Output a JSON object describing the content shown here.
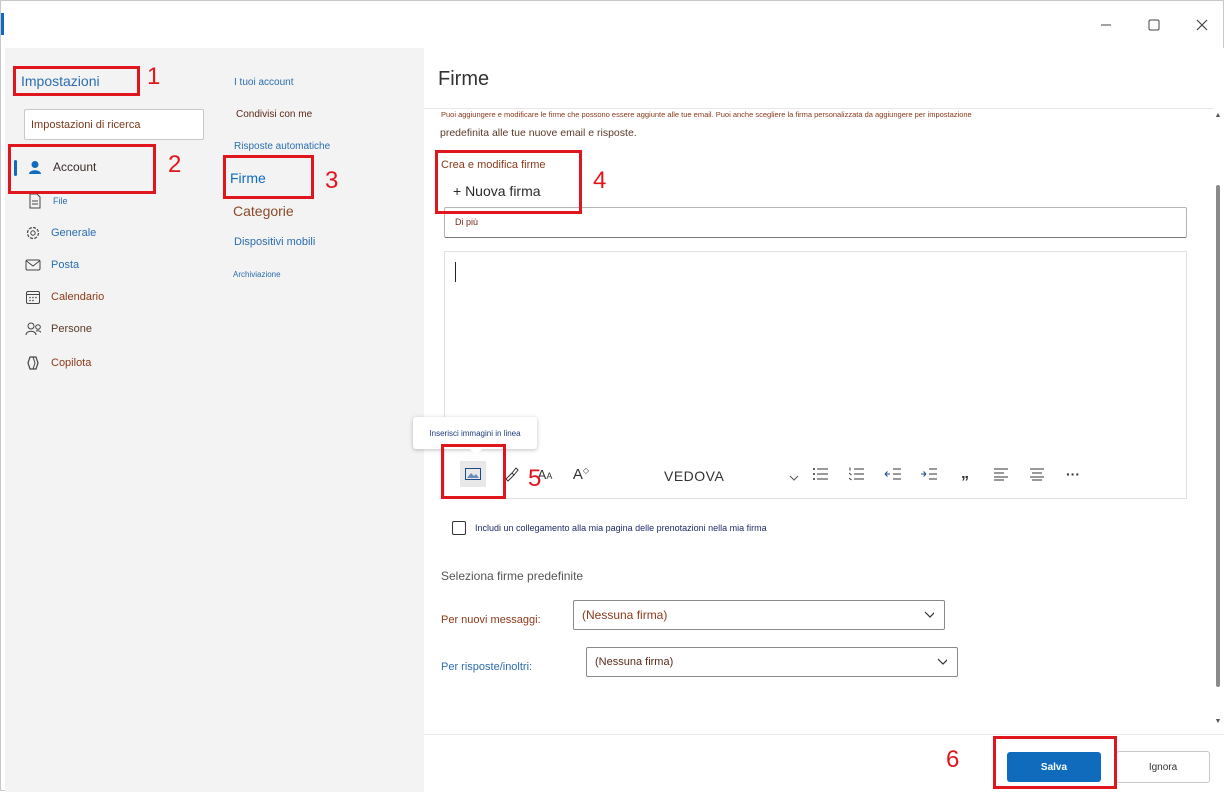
{
  "window": {
    "minimize_glyph": "—",
    "maximize_glyph": "☐",
    "close_glyph": "✕"
  },
  "nav1": {
    "title": "Impostazioni",
    "search_placeholder": "Impostazioni di ricerca",
    "items": [
      {
        "label": "Account",
        "icon": "person-icon"
      },
      {
        "label": "File",
        "icon": "file-icon"
      },
      {
        "label": "Generale",
        "icon": "gear-icon"
      },
      {
        "label": "Posta",
        "icon": "mail-icon"
      },
      {
        "label": "Calendario",
        "icon": "calendar-icon"
      },
      {
        "label": "Persone",
        "icon": "people-icon"
      },
      {
        "label": "Copilota",
        "icon": "copilot-icon"
      }
    ]
  },
  "nav2": {
    "items": [
      {
        "label": "I tuoi account"
      },
      {
        "label": "Condivisi con me"
      },
      {
        "label": "Risposte automatiche"
      },
      {
        "label": "Firme"
      },
      {
        "label": "Categorie"
      },
      {
        "label": "Dispositivi mobili"
      },
      {
        "label": "Archiviazione"
      }
    ]
  },
  "main": {
    "title": "Firme",
    "description_line1": "Puoi aggiungere e modificare le firme che possono essere aggiunte alle tue email. Puoi anche scegliere la firma personalizzata da aggiungere per impostazione",
    "description_line2": "predefinita alle tue nuove email e risposte.",
    "create_label": "Crea e modifica firme",
    "new_signature": "+ Nuova firma",
    "name_field_value": "Di più",
    "tooltip": "Inserisci immagini in linea",
    "font_name": "VEDOVA",
    "more_glyph": "···",
    "quote_glyph": "„",
    "checkbox_label": "Includi un collegamento alla mia pagina delle prenotazioni nella mia firma",
    "defaults_title": "Seleziona firme predefinite",
    "new_messages_label": "Per nuovi messaggi:",
    "new_messages_value": "(Nessuna firma)",
    "replies_label": "Per risposte/inoltri:",
    "replies_value": "(Nessuna firma)",
    "save_button": "Salva",
    "discard_button": "Ignora"
  },
  "annotations": [
    "1",
    "2",
    "3",
    "4",
    "5",
    "6"
  ],
  "colors": {
    "accent": "#0f6cbd",
    "annotation_red": "#e0161e",
    "nav_bg": "#f3f3f3"
  }
}
